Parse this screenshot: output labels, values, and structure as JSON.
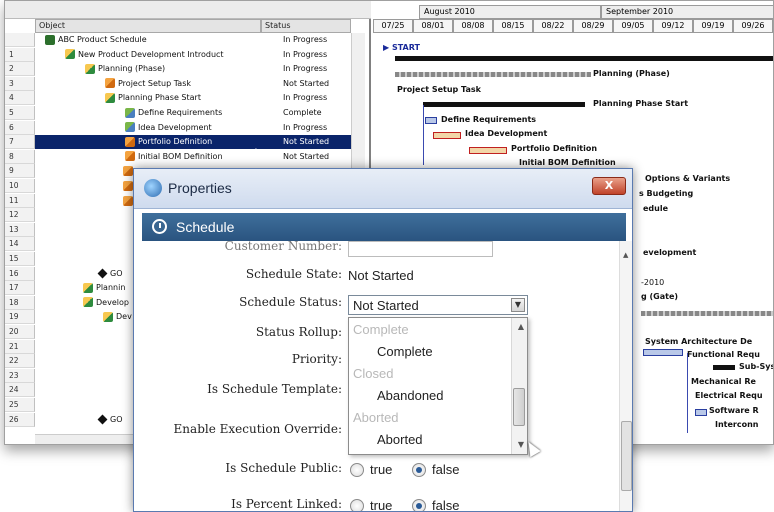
{
  "app": {
    "columns": {
      "object": "Object",
      "status": "Status"
    },
    "rows": [
      {
        "num": "",
        "label": "ABC Product Schedule",
        "status": "In Progress",
        "indent": 0,
        "icon": "pin"
      },
      {
        "num": "1",
        "label": "New Product Development Introduct",
        "status": "In Progress",
        "indent": 1,
        "icon": "phase"
      },
      {
        "num": "2",
        "label": "Planning  (Phase)",
        "status": "In Progress",
        "indent": 2,
        "icon": "phase"
      },
      {
        "num": "3",
        "label": "Project Setup Task",
        "status": "Not Started",
        "indent": 3,
        "icon": "task"
      },
      {
        "num": "4",
        "label": "Planning Phase Start",
        "status": "In Progress",
        "indent": 3,
        "icon": "phase"
      },
      {
        "num": "5",
        "label": "Define Requirements",
        "status": "Complete",
        "indent": 4,
        "icon": "check"
      },
      {
        "num": "6",
        "label": "Idea Development",
        "status": "In Progress",
        "indent": 4,
        "icon": "check"
      },
      {
        "num": "7",
        "label": "Portfolio Definition",
        "status": "Not Started",
        "indent": 4,
        "icon": "task"
      },
      {
        "num": "8",
        "label": "Initial BOM Definition",
        "status": "Not Started",
        "indent": 4,
        "icon": "task"
      }
    ],
    "extra_row_numbers": [
      "9",
      "10",
      "11",
      "12",
      "13",
      "14",
      "15",
      "16",
      "17",
      "18",
      "19",
      "20",
      "21",
      "22",
      "23",
      "24",
      "25",
      "26"
    ],
    "partial_rows": [
      {
        "row": "16",
        "label": "GO"
      },
      {
        "row": "17",
        "label": "Plannin"
      },
      {
        "row": "18",
        "label": "Develop"
      },
      {
        "row": "19",
        "label": "Dev"
      },
      {
        "row": "26",
        "label": "GO"
      }
    ],
    "months": [
      "August 2010",
      "September 2010"
    ],
    "weeks": [
      "07/25",
      "08/01",
      "08/08",
      "08/15",
      "08/22",
      "08/29",
      "09/05",
      "09/12",
      "09/19",
      "09/26"
    ],
    "gantt_labels": {
      "start": "START",
      "planning_phase": "Planning  (Phase)",
      "project_setup": "Project Setup Task",
      "planning_start": "Planning Phase Start",
      "define_req": "Define Requirements",
      "idea_dev": "Idea Development",
      "portfolio": "Portfolio Definition",
      "initial_bom": "Initial BOM Definition",
      "options": "Options & Variants",
      "budgeting": "s Budgeting",
      "schedule": "edule",
      "development": "evelopment",
      "year": "-2010",
      "gate": "g (Gate)",
      "sys_arch": "System Architecture De",
      "functional": "Functional Requ",
      "subsys": "Sub-Syst",
      "mechanical": "Mechanical Re",
      "electrical": "Electrical Requ",
      "software": "Software R",
      "interconn": "Interconn"
    }
  },
  "dialog": {
    "title": "Properties",
    "close_label": "X",
    "section_title": "Schedule",
    "partial_label": "Customer Number:",
    "fields": {
      "schedule_state_label": "Schedule State:",
      "schedule_state_value": "Not Started",
      "schedule_status_label": "Schedule Status:",
      "schedule_status_value": "Not Started",
      "status_rollup_label": "Status Rollup:",
      "priority_label": "Priority:",
      "template_label": "Is Schedule Template:",
      "override_label": "Enable Execution Override:",
      "public_label": "Is Schedule Public:",
      "percent_label": "Is Percent Linked:"
    },
    "dropdown": {
      "groups": [
        "Complete",
        "Closed",
        "Aborted"
      ],
      "items": [
        "Complete",
        "Abandoned",
        "Aborted"
      ]
    },
    "radio_true": "true",
    "radio_false": "false",
    "public_value": "false",
    "percent_value": "false"
  }
}
